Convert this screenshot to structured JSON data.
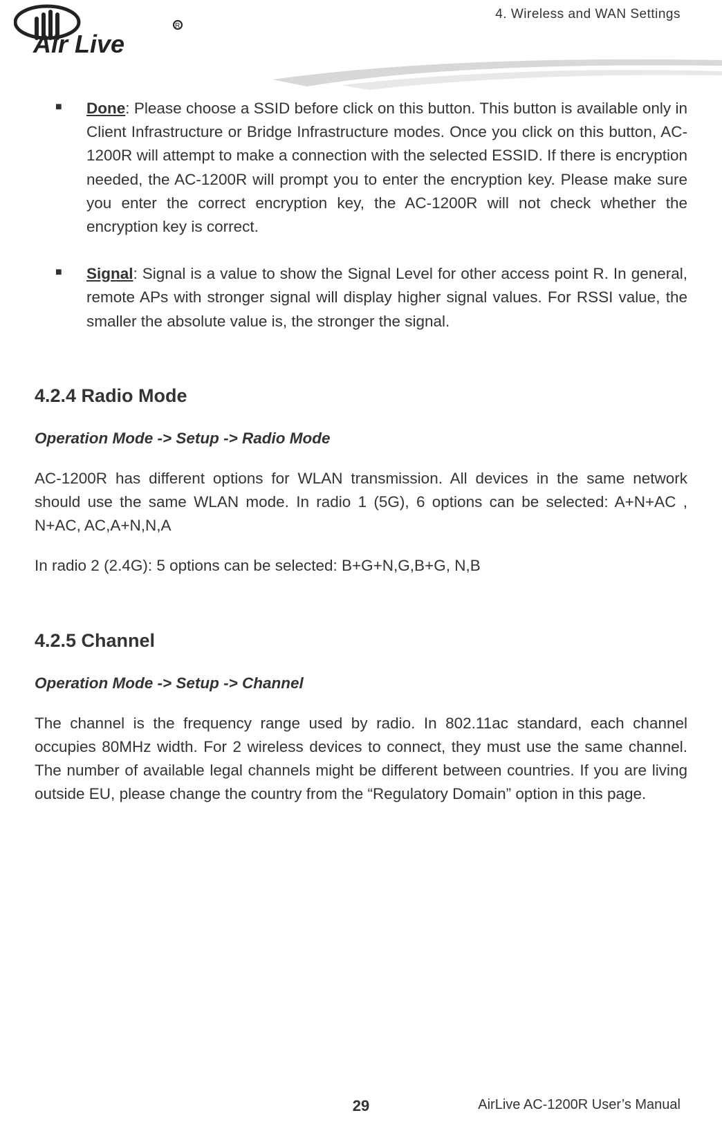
{
  "header": {
    "chapter": "4. Wireless and WAN Settings",
    "brand": "Air Live"
  },
  "bullets": [
    {
      "term": "Done",
      "text": ": Please choose a SSID before click on this button. This button is available only in Client Infrastructure or Bridge Infrastructure modes. Once you click on this button, AC-1200R will attempt to make a connection with the selected ESSID. If there is encryption needed, the AC-1200R will prompt you to enter the encryption key. Please make sure you enter the correct encryption key, the AC-1200R will not check whether the encryption key is correct."
    },
    {
      "term": "Signal",
      "text": ": Signal is a value to show the Signal Level for other access point R. In general, remote APs with stronger signal will display higher signal values. For RSSI value, the smaller the absolute value is, the stronger the signal."
    }
  ],
  "sections": [
    {
      "heading": "4.2.4 Radio Mode",
      "breadcrumb": "Operation Mode -> Setup -> Radio Mode",
      "paragraphs": [
        "AC-1200R has different options for WLAN transmission. All devices in the same network should use the same WLAN mode. In radio 1 (5G), 6 options can be selected: A+N+AC , N+AC, AC,A+N,N,A",
        "In radio 2 (2.4G): 5 options can be selected: B+G+N,G,B+G, N,B"
      ]
    },
    {
      "heading": "4.2.5 Channel",
      "breadcrumb": "Operation Mode -> Setup -> Channel",
      "paragraphs": [
        "The channel is the frequency range used by radio. In 802.11ac standard, each channel occupies 80MHz width.   For 2 wireless devices to connect, they must use the same channel. The number of available legal channels might be different between countries. If you are living outside EU, please change the country from the “Regulatory Domain” option in this page."
      ]
    }
  ],
  "footer": {
    "page": "29",
    "manual": "AirLive AC-1200R User’s Manual"
  }
}
